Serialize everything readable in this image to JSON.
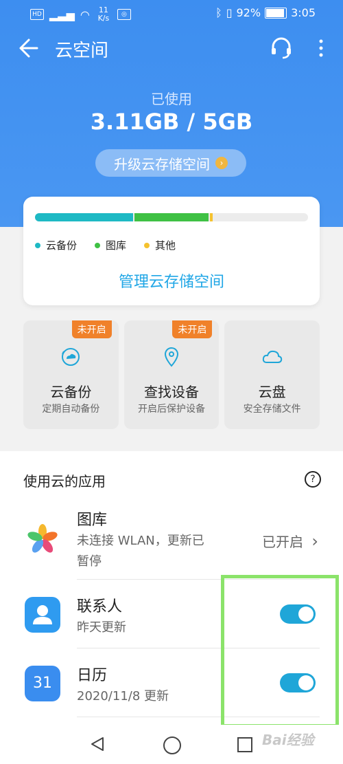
{
  "status_bar": {
    "hd": "HD",
    "net_speed": "11 K/s",
    "battery": "92%",
    "time": "3:05"
  },
  "topbar": {
    "title": "云空间"
  },
  "storage": {
    "used_label": "已使用",
    "used_value": "3.11GB / 5GB",
    "upgrade_label": "升级云存储空间",
    "segments": [
      {
        "name": "云备份",
        "color": "#1eb9c4",
        "fraction": 0.36
      },
      {
        "name": "图库",
        "color": "#3fc144",
        "fraction": 0.27
      },
      {
        "name": "其他",
        "color": "#f5c22e",
        "fraction": 0.01
      }
    ],
    "manage_label": "管理云存储空间"
  },
  "tiles": [
    {
      "badge": "未开启",
      "name": "云备份",
      "sub": "定期自动备份",
      "icon": "cloud-sync-icon"
    },
    {
      "badge": "未开启",
      "name": "查找设备",
      "sub": "开启后保护设备",
      "icon": "location-pin-icon"
    },
    {
      "badge": "",
      "name": "云盘",
      "sub": "安全存储文件",
      "icon": "cloud-icon"
    }
  ],
  "apps_section": {
    "title": "使用云的应用",
    "apps": [
      {
        "name": "图库",
        "sub_line1": "未连接 WLAN，更新已",
        "sub_line2": "暂停",
        "status": "已开启",
        "icon": "gallery-icon"
      },
      {
        "name": "联系人",
        "sub_line1": "昨天更新",
        "toggle": true,
        "icon": "contacts-icon"
      },
      {
        "name": "日历",
        "sub_line1": "2020/11/8 更新",
        "toggle": true,
        "icon": "calendar-icon",
        "icon_text": "31"
      }
    ]
  },
  "watermark": "Bai经验"
}
